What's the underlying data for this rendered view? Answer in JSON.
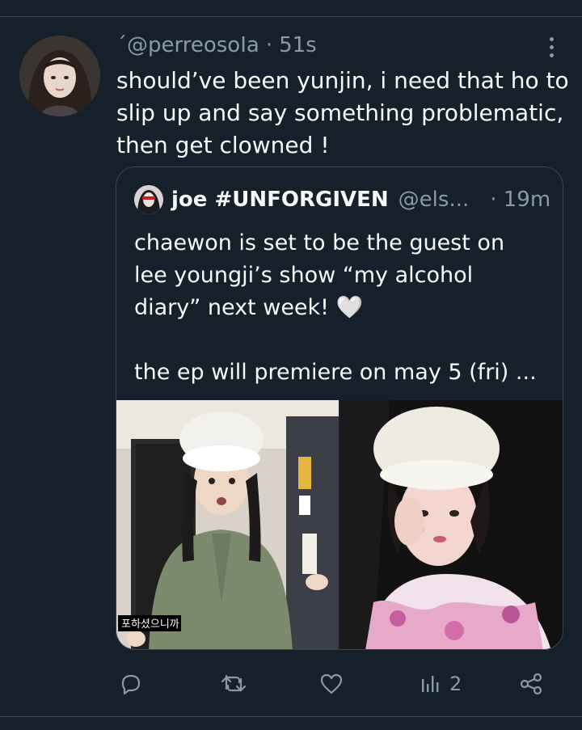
{
  "tweet": {
    "handle": "@perreosoIa",
    "handle_prefix": "ˊ",
    "separator": "·",
    "time": "51s",
    "lines": [
      "should’ve been yunjin, i need that ho to",
      "slip up and say something problematic,",
      "then get clowned !"
    ],
    "more_icon": "more-horizontal-icon"
  },
  "quote": {
    "name": "joe #UNFORGIVEN",
    "handle": "@els...",
    "separator": "·",
    "time": "19m",
    "lines": [
      "chaewon is set to be the guest on",
      "lee youngji’s show “my alcohol",
      "diary” next week! 🤍",
      "",
      "the ep will premiere on may 5 (fri) ..."
    ],
    "photo_caption": "포하셨으니까"
  },
  "actions": {
    "reply_icon": "reply-icon",
    "retweet_icon": "retweet-icon",
    "like_icon": "heart-icon",
    "views_icon": "views-icon",
    "views_count": "2",
    "share_icon": "share-icon"
  },
  "colors": {
    "background": "#15202b",
    "border": "#38444d",
    "text_primary": "#f7f9f9",
    "text_secondary": "#8b98a5"
  }
}
